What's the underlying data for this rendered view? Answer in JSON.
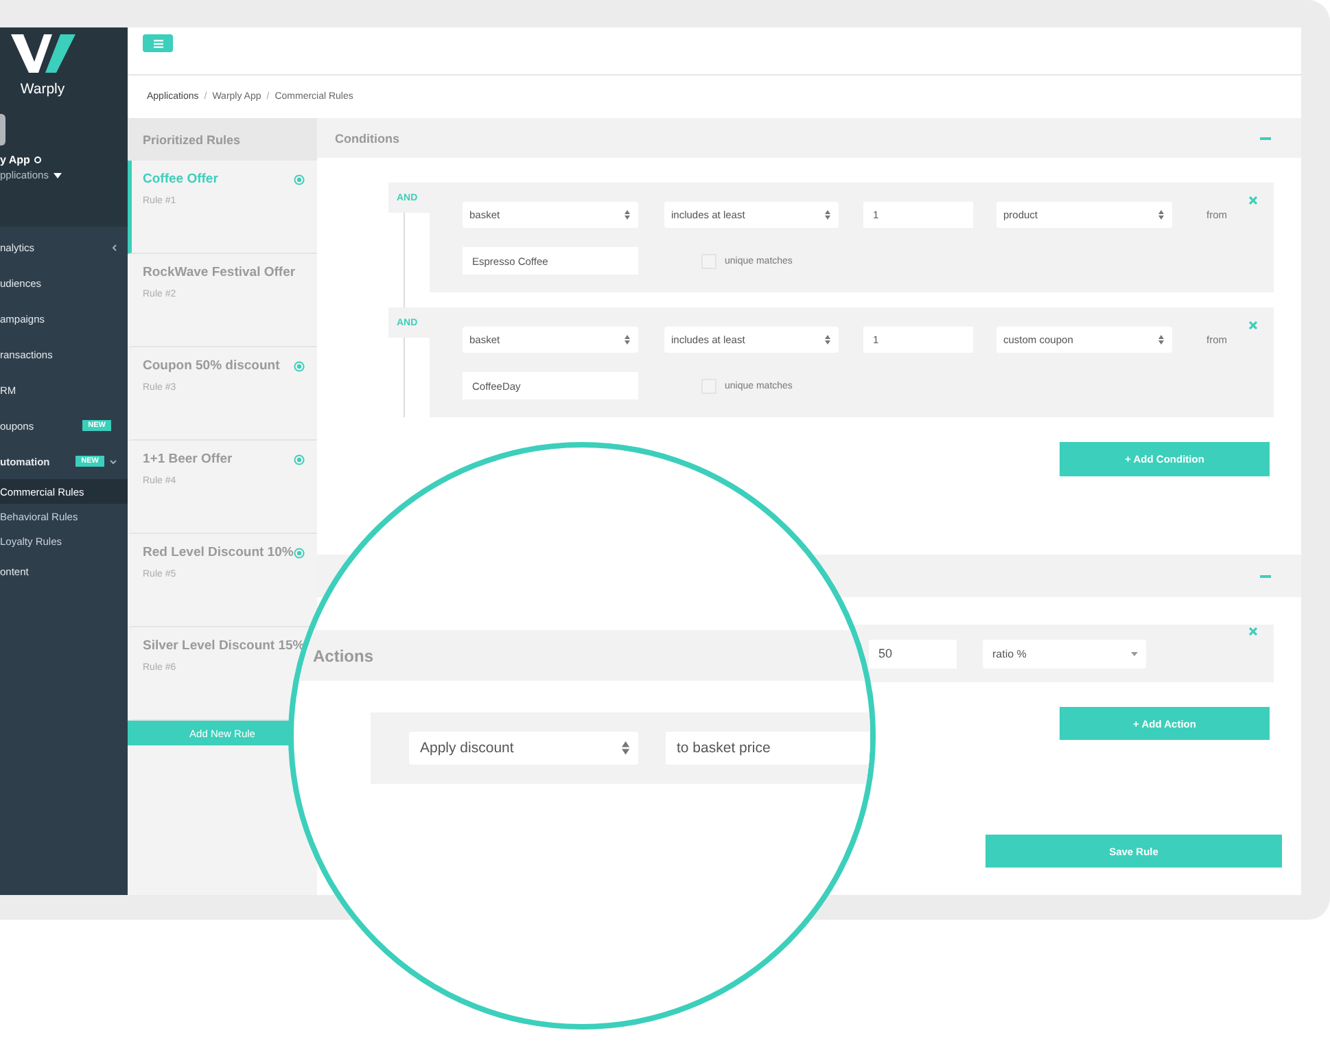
{
  "sidebar": {
    "logo_text": "Warply",
    "app_name": "y App",
    "app_switcher": "pplications",
    "items": [
      {
        "label": "nalytics",
        "collapsible": true,
        "expanded": false
      },
      {
        "label": "udiences",
        "collapsible": false,
        "expanded": false
      },
      {
        "label": "ampaigns",
        "collapsible": false,
        "expanded": false
      },
      {
        "label": "ransactions",
        "collapsible": false,
        "expanded": false
      },
      {
        "label": "RM",
        "collapsible": false,
        "expanded": false
      },
      {
        "label": "oupons",
        "badge": "NEW",
        "collapsible": false,
        "expanded": false
      },
      {
        "label": "utomation",
        "badge": "NEW",
        "collapsible": true,
        "expanded": true,
        "children": [
          {
            "label": "Commercial Rules",
            "selected": true
          },
          {
            "label": "Behavioral Rules",
            "selected": false
          },
          {
            "label": "Loyalty Rules",
            "selected": false
          }
        ]
      },
      {
        "label": "ontent",
        "collapsible": false,
        "expanded": false
      }
    ]
  },
  "breadcrumb": {
    "separator": "/",
    "items": [
      "Applications",
      "Warply App",
      "Commercial Rules"
    ]
  },
  "rules": {
    "title": "Prioritized Rules",
    "add_button": "Add New Rule",
    "items": [
      {
        "title": "Coffee Offer",
        "number": "Rule #1",
        "selected": true,
        "active": true
      },
      {
        "title": "RockWave Festival Offer",
        "number": "Rule #2",
        "selected": false,
        "active": false
      },
      {
        "title": "Coupon 50% discount",
        "number": "Rule #3",
        "selected": false,
        "active": true
      },
      {
        "title": "1+1 Beer Offer",
        "number": "Rule #4",
        "selected": false,
        "active": true
      },
      {
        "title": "Red Level Discount 10%",
        "number": "Rule #5",
        "selected": false,
        "active": true
      },
      {
        "title": "Silver Level Discount 15%",
        "number": "Rule #6",
        "selected": false,
        "active": false
      }
    ]
  },
  "conditions": {
    "title": "Conditions",
    "add_button": "+ Add Condition",
    "items": [
      {
        "operator": "AND",
        "source": "basket",
        "comparison": "includes at least",
        "quantity": "1",
        "target": "product",
        "from_label": "from",
        "value": "Espresso Coffee",
        "unique_label": "unique matches",
        "unique_checked": false
      },
      {
        "operator": "AND",
        "source": "basket",
        "comparison": "includes at least",
        "quantity": "1",
        "target": "custom coupon",
        "from_label": "from",
        "value": "CoffeeDay",
        "unique_label": "unique matches",
        "unique_checked": false
      }
    ]
  },
  "actions": {
    "title": "Actions",
    "add_button": "+ Add Action",
    "items": [
      {
        "action": "Apply discount",
        "applies_to": "to basket price",
        "amount": "50",
        "unit": "ratio %"
      }
    ]
  },
  "save_button": "Save Rule"
}
